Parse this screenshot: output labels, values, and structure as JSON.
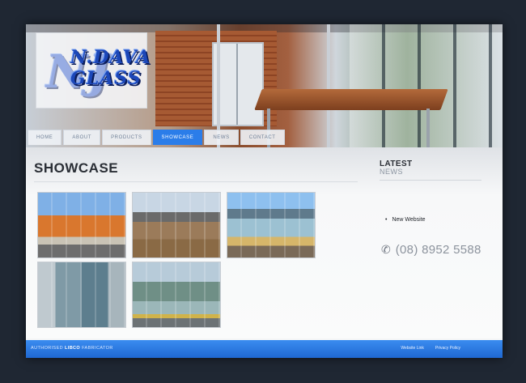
{
  "logo": {
    "line1": "N.DAVA",
    "line2": "GLASS"
  },
  "nav": {
    "items": [
      {
        "label": "HOME",
        "active": false
      },
      {
        "label": "ABOUT",
        "active": false
      },
      {
        "label": "PRODUCTS",
        "active": false
      },
      {
        "label": "SHOWCASE",
        "active": true
      },
      {
        "label": "NEWS",
        "active": false
      },
      {
        "label": "CONTACT",
        "active": false
      }
    ]
  },
  "main": {
    "title": "SHOWCASE"
  },
  "sidebar": {
    "title": "LATEST",
    "subtitle": "NEWS",
    "news_items": [
      "New Website"
    ],
    "phone_icon": "phone-icon",
    "phone": "(08) 8952 5588"
  },
  "footer": {
    "left_prefix": "AUTHORISED",
    "left_brand": "LIBCO",
    "left_suffix": "FABRICATOR",
    "links": [
      "Website Link",
      "Privacy Policy"
    ]
  },
  "colors": {
    "accent": "#2b7de9",
    "background": "#1f2733",
    "title": "#2a2e35"
  }
}
